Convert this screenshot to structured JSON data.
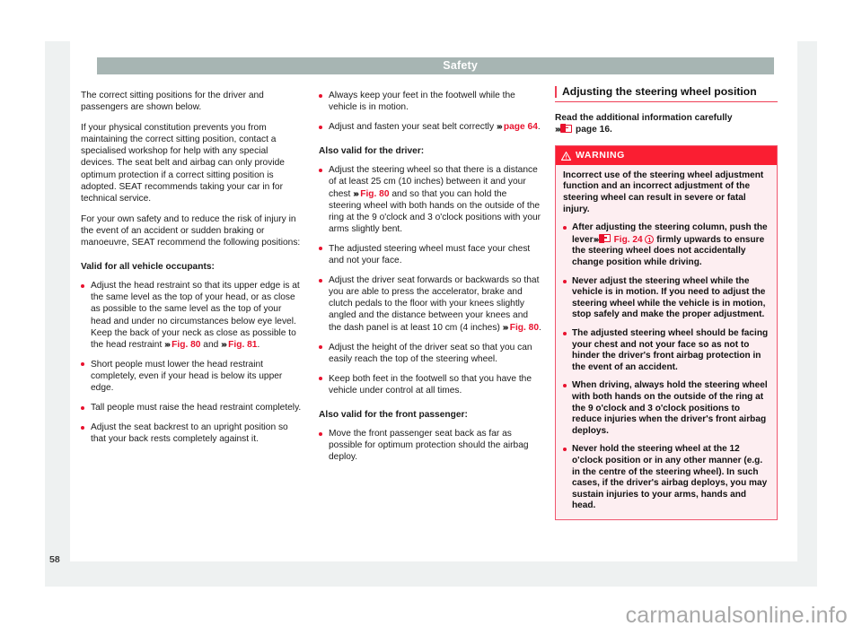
{
  "header": {
    "chapter_title": "Safety"
  },
  "folio": {
    "page_number": "58"
  },
  "watermark": {
    "text": "carmanualsonline.info"
  },
  "icons": {
    "book": "manual-book-icon",
    "warning_triangle": "warning-triangle-icon",
    "chevrons": "›››"
  },
  "colors": {
    "chapter_bar": "#a7b5b3",
    "accent_red": "#e8112d",
    "warning_header": "#fa1e32",
    "warning_bg": "#fdeef1",
    "warning_border": "#f0566e",
    "heading_rule": "#ef3f56",
    "page_mat": "#eef1f1"
  },
  "column_one": {
    "paragraph_1": "The correct sitting positions for the driver and passengers are shown below.",
    "paragraph_2": "If your physical constitution prevents you from maintaining the correct sitting position, contact a specialised workshop for help with any special devices. The seat belt and airbag can only provide optimum protection if a correct sitting position is adopted. SEAT recommends taking your car in for technical service.",
    "paragraph_3": "For your own safety and to reduce the risk of injury in the event of an accident or sudden braking or manoeuvre, SEAT recommend the following positions:",
    "subhead": "Valid for all vehicle occupants:",
    "bullet_1_pre": "Adjust the head restraint so that its upper edge is at the same level as the top of your head, or as close as possible to the same level as the top of your head and under no circumstances below eye level. Keep the back of your neck as close as possible to the head restraint ",
    "bullet_1_ref_a": "Fig. 80",
    "bullet_1_mid": " and ",
    "bullet_1_ref_b": "Fig. 81",
    "bullet_1_post": ".",
    "bullet_2": "Short people must lower the head restraint completely, even if your head is below its upper edge.",
    "bullet_3": "Tall people must raise the head restraint completely.",
    "bullet_4": "Adjust the seat backrest to an upright position so that your back rests completely against it."
  },
  "column_two": {
    "bullet_1": "Always keep your feet in the footwell while the vehicle is in motion.",
    "bullet_2_pre": "Adjust and fasten your seat belt correctly ",
    "bullet_2_ref": "page 64",
    "bullet_2_post": ".",
    "subhead_driver": "Also valid for the driver:",
    "bullet_3_pre": "Adjust the steering wheel so that there is a distance of at least 25 cm (10 inches) between it and your chest ",
    "bullet_3_ref": "Fig. 80",
    "bullet_3_post": " and so that you can hold the steering wheel with both hands on the outside of the ring at the 9 o'clock and 3 o'clock positions with your arms slightly bent.",
    "bullet_4": "The adjusted steering wheel must face your chest and not your face.",
    "bullet_5_pre": "Adjust the driver seat forwards or backwards so that you are able to press the accelerator, brake and clutch pedals to the floor with your knees slightly angled and the distance between your knees and the dash panel is at least 10 cm (4 inches) ",
    "bullet_5_ref": "Fig. 80",
    "bullet_5_post": ".",
    "bullet_6": "Adjust the height of the driver seat so that you can easily reach the top of the steering wheel.",
    "bullet_7": "Keep both feet in the footwell so that you have the vehicle under control at all times.",
    "subhead_passenger": "Also valid for the front passenger:",
    "bullet_8": "Move the front passenger seat back as far as possible for optimum protection should the airbag deploy."
  },
  "column_three": {
    "section_heading": "Adjusting the steering wheel position",
    "read_info_line1": "Read the additional information carefully",
    "read_info_ref": "page 16",
    "read_info_post": ".",
    "warning_label": "WARNING",
    "warning_intro": "Incorrect use of the steering wheel adjustment function and an incorrect adjustment of the steering wheel can result in severe or fatal injury.",
    "warning_bullet_1_pre": "After adjusting the steering column, push the lever",
    "warning_bullet_1_ref": "Fig. 24",
    "warning_bullet_1_callout": "1",
    "warning_bullet_1_post": " firmly upwards to ensure the steering wheel does not accidentally change position while driving.",
    "warning_bullet_2": "Never adjust the steering wheel while the vehicle is in motion. If you need to adjust the steering wheel while the vehicle is in motion, stop safely and make the proper adjustment.",
    "warning_bullet_3": "The adjusted steering wheel should be facing your chest and not your face so as not to hinder the driver's front airbag protection in the event of an accident.",
    "warning_bullet_4": "When driving, always hold the steering wheel with both hands on the outside of the ring at the 9 o'clock and 3 o'clock positions to reduce injuries when the driver's front airbag deploys.",
    "warning_bullet_5": "Never hold the steering wheel at the 12 o'clock position or in any other manner (e.g. in the centre of the steering wheel). In such cases, if the driver's airbag deploys, you may sustain injuries to your arms, hands and head."
  }
}
